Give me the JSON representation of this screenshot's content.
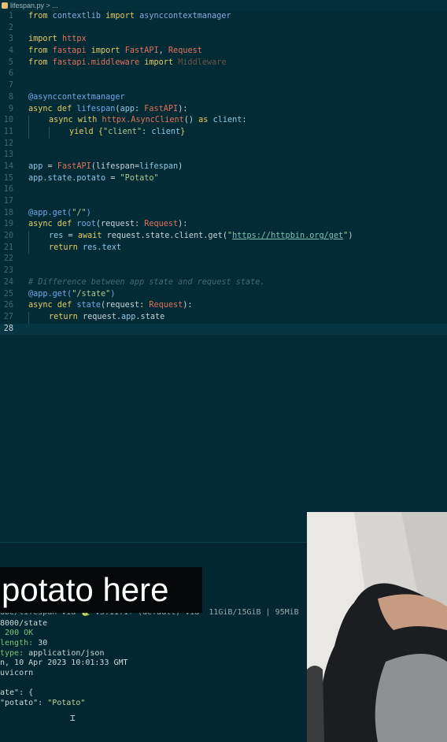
{
  "tab": {
    "filename": "lifespan.py",
    "breadcrumb": "> ..."
  },
  "editor": {
    "lines": [
      {
        "n": "1"
      },
      {
        "n": "2"
      },
      {
        "n": "3"
      },
      {
        "n": "4"
      },
      {
        "n": "5"
      },
      {
        "n": "6"
      },
      {
        "n": "7"
      },
      {
        "n": "8"
      },
      {
        "n": "9"
      },
      {
        "n": "10"
      },
      {
        "n": "11"
      },
      {
        "n": "12"
      },
      {
        "n": "13"
      },
      {
        "n": "14"
      },
      {
        "n": "15"
      },
      {
        "n": "16"
      },
      {
        "n": "17"
      },
      {
        "n": "18"
      },
      {
        "n": "19"
      },
      {
        "n": "20"
      },
      {
        "n": "21"
      },
      {
        "n": "22"
      },
      {
        "n": "23"
      },
      {
        "n": "24"
      },
      {
        "n": "25"
      },
      {
        "n": "26"
      },
      {
        "n": "27"
      },
      {
        "n": "28"
      }
    ],
    "code": {
      "l1": [
        "from",
        " contextlib ",
        "import",
        " asynccontextmanager"
      ],
      "l3": [
        "import",
        " httpx"
      ],
      "l4": [
        "from",
        " fastapi ",
        "import",
        " FastAPI",
        ", ",
        "Request"
      ],
      "l5": [
        "from",
        " fastapi.middleware ",
        "import",
        " Middleware"
      ],
      "l8": "@asynccontextmanager",
      "l9": [
        "async def ",
        "lifespan",
        "(",
        "app",
        ": ",
        "FastAPI",
        "):"
      ],
      "l10": [
        "async with ",
        "httpx.AsyncClient",
        "() ",
        "as ",
        "client",
        ":"
      ],
      "l11": [
        "yield ",
        "{",
        "\"client\"",
        ": ",
        "client",
        "}"
      ],
      "l14": [
        "app",
        " = ",
        "FastAPI",
        "(lifespan=",
        "lifespan",
        ")"
      ],
      "l15": [
        "app.state.potato",
        " = ",
        "\"Potato\""
      ],
      "l18": [
        "@app.get(",
        "\"/\"",
        ")"
      ],
      "l19": [
        "async def ",
        "root",
        "(request: ",
        "Request",
        "):"
      ],
      "l20": [
        "res",
        " = ",
        "await",
        " request.state.client.get(",
        "\"",
        "https://httpbin.org/get",
        "\"",
        ")"
      ],
      "l21": [
        "return ",
        "res.text"
      ],
      "l24": "# Difference between app state and request state.",
      "l25": [
        "@app.get(",
        "\"/state\"",
        ")"
      ],
      "l26": [
        "async def ",
        "state",
        "(request: ",
        "Request",
        "):"
      ],
      "l27": [
        "return ",
        "request.",
        "app",
        ".state"
      ]
    }
  },
  "caption": "potato here",
  "terminal": {
    "prompt": "ube/lifespan via 🐍 v3.11.1+ (default) via  11GiB/15GiB | 95MiB",
    "url": "8000/state",
    "status": "200 OK",
    "length_label": "length:",
    "length_value": "30",
    "type_label": "type:",
    "type_value": "application/json",
    "date": "n, 10 Apr 2023 10:01:33 GMT",
    "server": "uvicorn",
    "json_open": "ate\": {",
    "json_key": "\"potato\"",
    "json_colon": ": ",
    "json_value": "\"Potato\""
  },
  "colors": {
    "editor_bg": "#032b36",
    "keyword": "#e6cb63",
    "class": "#e3725b",
    "string": "#b1c88f"
  }
}
